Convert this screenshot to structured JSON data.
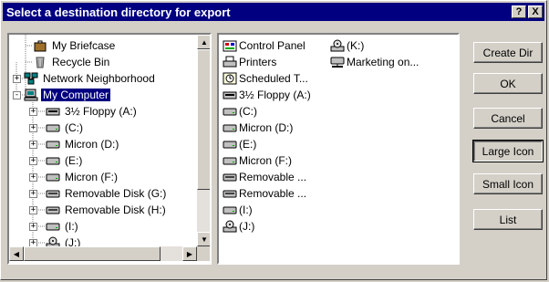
{
  "window": {
    "title": "Select a destination directory for export",
    "help_label": "?",
    "close_label": "X"
  },
  "tree": {
    "items": [
      {
        "label": "My Briefcase",
        "icon": "briefcase-icon"
      },
      {
        "label": "Recycle Bin",
        "icon": "recycle-bin-icon"
      },
      {
        "label": "Network Neighborhood",
        "icon": "network-icon",
        "expander": "+"
      },
      {
        "label": "My Computer",
        "icon": "computer-icon",
        "expander": "-",
        "selected": true
      },
      {
        "label": "3½ Floppy (A:)",
        "icon": "floppy-drive-icon",
        "expander": "+"
      },
      {
        "label": "(C:)",
        "icon": "hard-drive-icon",
        "expander": "+"
      },
      {
        "label": "Micron (D:)",
        "icon": "hard-drive-icon",
        "expander": "+"
      },
      {
        "label": "(E:)",
        "icon": "hard-drive-icon",
        "expander": "+"
      },
      {
        "label": "Micron (F:)",
        "icon": "hard-drive-icon",
        "expander": "+"
      },
      {
        "label": "Removable Disk (G:)",
        "icon": "removable-disk-icon",
        "expander": "+"
      },
      {
        "label": "Removable Disk (H:)",
        "icon": "removable-disk-icon",
        "expander": "+"
      },
      {
        "label": "(I:)",
        "icon": "hard-drive-icon",
        "expander": "+"
      },
      {
        "label": "(J:)",
        "icon": "cd-drive-icon",
        "expander": "+"
      }
    ]
  },
  "list": {
    "items": [
      {
        "label": "Control Panel",
        "icon": "control-panel-icon"
      },
      {
        "label": "Printers",
        "icon": "printers-icon"
      },
      {
        "label": "Scheduled T...",
        "icon": "scheduled-tasks-icon"
      },
      {
        "label": "3½ Floppy (A:)",
        "icon": "floppy-drive-icon"
      },
      {
        "label": "(C:)",
        "icon": "hard-drive-icon"
      },
      {
        "label": "Micron (D:)",
        "icon": "hard-drive-icon"
      },
      {
        "label": "(E:)",
        "icon": "hard-drive-icon"
      },
      {
        "label": "Micron (F:)",
        "icon": "hard-drive-icon"
      },
      {
        "label": "Removable ...",
        "icon": "removable-disk-icon"
      },
      {
        "label": "Removable ...",
        "icon": "removable-disk-icon"
      },
      {
        "label": "(I:)",
        "icon": "hard-drive-icon"
      },
      {
        "label": "(J:)",
        "icon": "cd-drive-icon"
      },
      {
        "label": "(K:)",
        "icon": "cd-drive-icon"
      },
      {
        "label": "Marketing on...",
        "icon": "network-drive-icon"
      }
    ]
  },
  "buttons": {
    "create_dir": "Create Dir",
    "ok": "OK",
    "cancel": "Cancel",
    "large_icon": "Large Icon",
    "small_icon": "Small Icon",
    "list": "List"
  }
}
